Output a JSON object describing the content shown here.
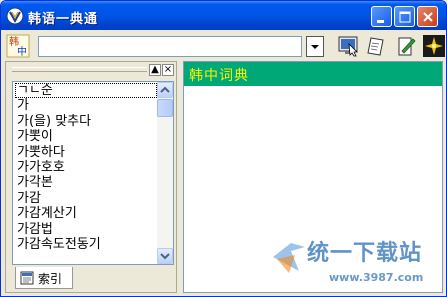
{
  "window": {
    "title": "韩语一典通"
  },
  "toolbar": {
    "kr_button_text_top": "韩",
    "kr_button_text_bottom": "中",
    "search_value": "",
    "search_placeholder": ""
  },
  "left_pane": {
    "min_label": "▲",
    "close_label": "×",
    "items": [
      "ㄱㄴ순",
      "가",
      "가(을) 맞추다",
      "가뽓이",
      "가뽓하다",
      "가가호호",
      "가각본",
      "가감",
      "가감계산기",
      "가감법",
      "가감속도전동기"
    ],
    "tab_label": "索引"
  },
  "right_pane": {
    "header_title": "韩中词典"
  },
  "watermark": {
    "text": "统一下载站",
    "url": "www.3987.com"
  },
  "colors": {
    "titlebar": "#0055e5",
    "dict_header": "#00a878",
    "dict_header_text": "#f4f400"
  }
}
